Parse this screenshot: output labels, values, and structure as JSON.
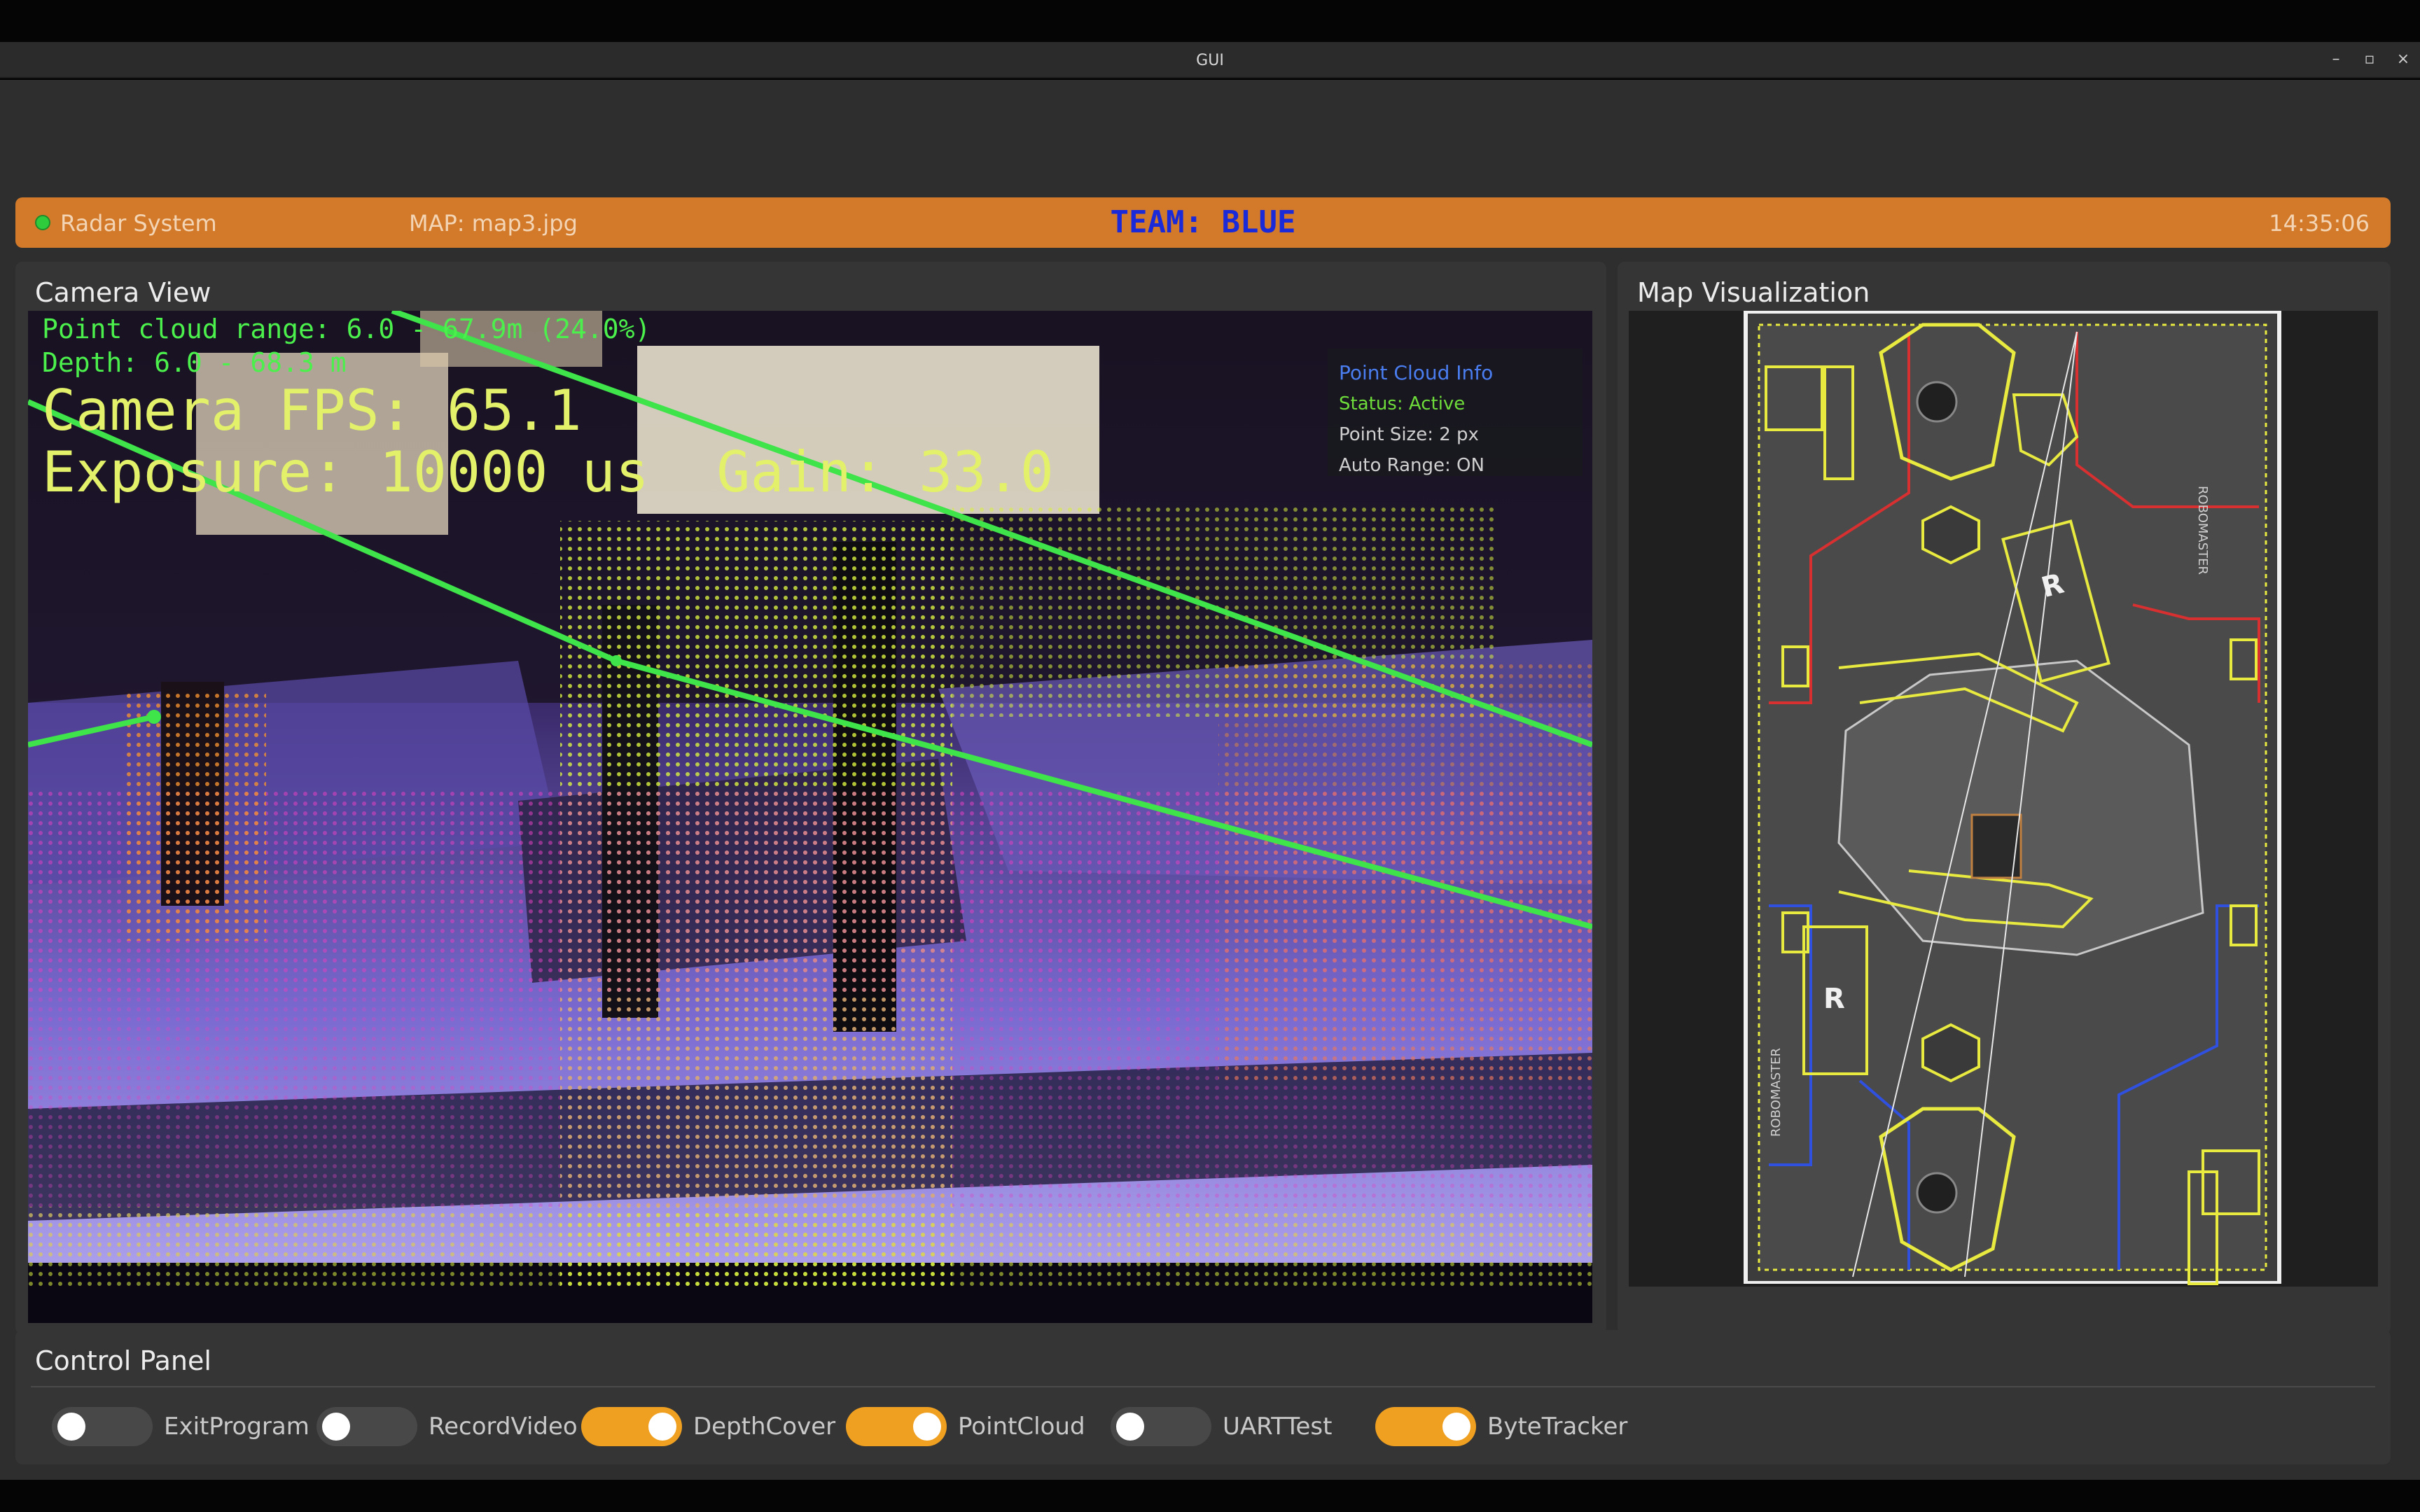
{
  "window": {
    "title": "GUI",
    "buttons": [
      "–",
      "▫",
      "×"
    ]
  },
  "header": {
    "system_label": "Radar System",
    "map_label": "MAP: map3.jpg",
    "team_label": "TEAM: BLUE",
    "clock": "14:35:06",
    "status_color": "#2ecc3c",
    "accent": "#d27a2a"
  },
  "camera_panel": {
    "title": "Camera View",
    "overlay": {
      "line1": "Point cloud range: 6.0 - 67.9m (24.0%)",
      "line2": "Depth: 6.0 - 68.3 m",
      "line3": "Camera FPS: 65.1",
      "line4": "Exposure: 10000 us  Gain: 33.0"
    },
    "pc_info": {
      "title": "Point Cloud Info",
      "status": "Status: Active",
      "point_size": "Point Size: 2 px",
      "auto_range": "Auto Range: ON"
    }
  },
  "map_panel": {
    "title": "Map Visualization",
    "labels": [
      "R",
      "R",
      "ROBOMASTER",
      "ROBOMASTER"
    ]
  },
  "control_panel": {
    "title": "Control Panel",
    "toggles": [
      {
        "label": "ExitProgram",
        "on": false
      },
      {
        "label": "RecordVideo",
        "on": false
      },
      {
        "label": "DepthCover",
        "on": true
      },
      {
        "label": "PointCloud",
        "on": true
      },
      {
        "label": "UARTTest",
        "on": false
      },
      {
        "label": "ByteTracker",
        "on": true
      }
    ]
  }
}
